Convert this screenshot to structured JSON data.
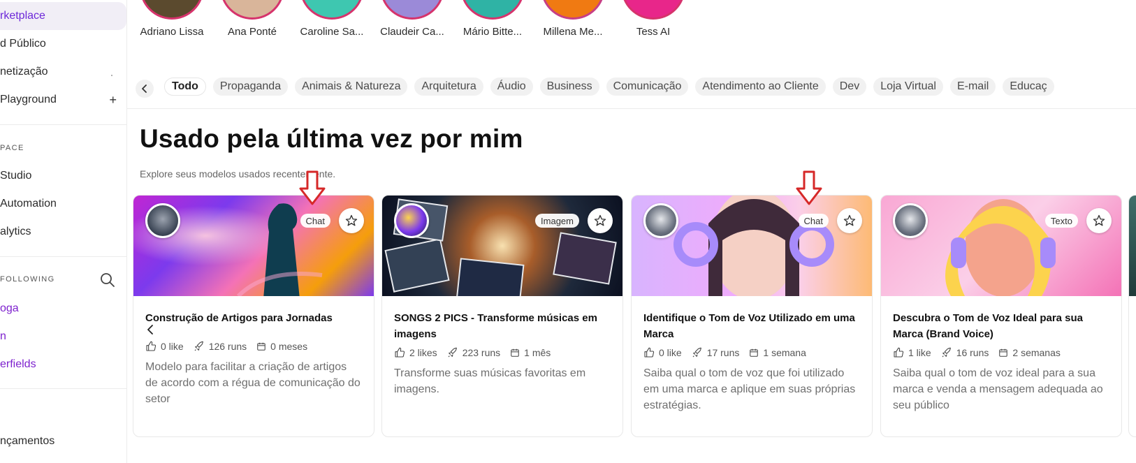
{
  "sidebar": {
    "items": [
      {
        "label": "rketplace"
      },
      {
        "label": "d Público"
      },
      {
        "label": "netização"
      },
      {
        "label": "Playground"
      },
      {
        "label": "Studio"
      },
      {
        "label": "Automation"
      },
      {
        "label": "alytics"
      },
      {
        "label": "nçamentos"
      }
    ],
    "section_space": "PACE",
    "section_following": "FOLLOWING",
    "links": [
      "oga",
      "n",
      "erfields"
    ],
    "plus": "+"
  },
  "avatars": [
    {
      "name": "Adriano Lissa",
      "color": "#5b4a2e"
    },
    {
      "name": "Ana Ponté",
      "color": "#d9b59a"
    },
    {
      "name": "Caroline Sa...",
      "color": "#3ec7b0"
    },
    {
      "name": "Claudeir Ca...",
      "color": "#9b8ad8"
    },
    {
      "name": "Mário Bitte...",
      "color": "#2fb3a5"
    },
    {
      "name": "Millena Me...",
      "color": "#f07a12"
    },
    {
      "name": "Tess AI",
      "color": "#e8268a"
    }
  ],
  "categories": [
    "Todo",
    "Propaganda",
    "Animais & Natureza",
    "Arquitetura",
    "Áudio",
    "Business",
    "Comunicação",
    "Atendimento ao Cliente",
    "Dev",
    "Loja Virtual",
    "E-mail",
    "Educaç"
  ],
  "section": {
    "title": "Usado pela última vez por mim",
    "subtitle": "Explore seus modelos usados recentemente."
  },
  "cards": [
    {
      "tag": "Chat",
      "title": "Construção de Artigos para Jornadas",
      "likes": "0 like",
      "runs": "126 runs",
      "time": "0 meses",
      "desc": "Modelo para facilitar a criação de artigos de acordo com a régua de comunicação do setor"
    },
    {
      "tag": "Imagem",
      "title": "SONGS 2 PICS - Transforme músicas em imagens",
      "likes": "2 likes",
      "runs": "223 runs",
      "time": "1 mês",
      "desc": "Transforme suas músicas favoritas em imagens."
    },
    {
      "tag": "Chat",
      "title": "Identifique o Tom de Voz Utilizado em uma Marca",
      "likes": "0 like",
      "runs": "17 runs",
      "time": "1 semana",
      "desc": "Saiba qual o tom de voz que foi utilizado em uma marca e aplique em suas próprias estratégias."
    },
    {
      "tag": "Texto",
      "title": "Descubra o Tom de Voz Ideal para sua Marca (Brand Voice)",
      "likes": "1 like",
      "runs": "16 runs",
      "time": "2 semanas",
      "desc": "Saiba qual o tom de voz ideal para a sua marca e venda a mensagem adequada ao seu público"
    }
  ],
  "colors": {
    "accent": "#7e22ce",
    "annotation_arrow": "#d62828"
  }
}
